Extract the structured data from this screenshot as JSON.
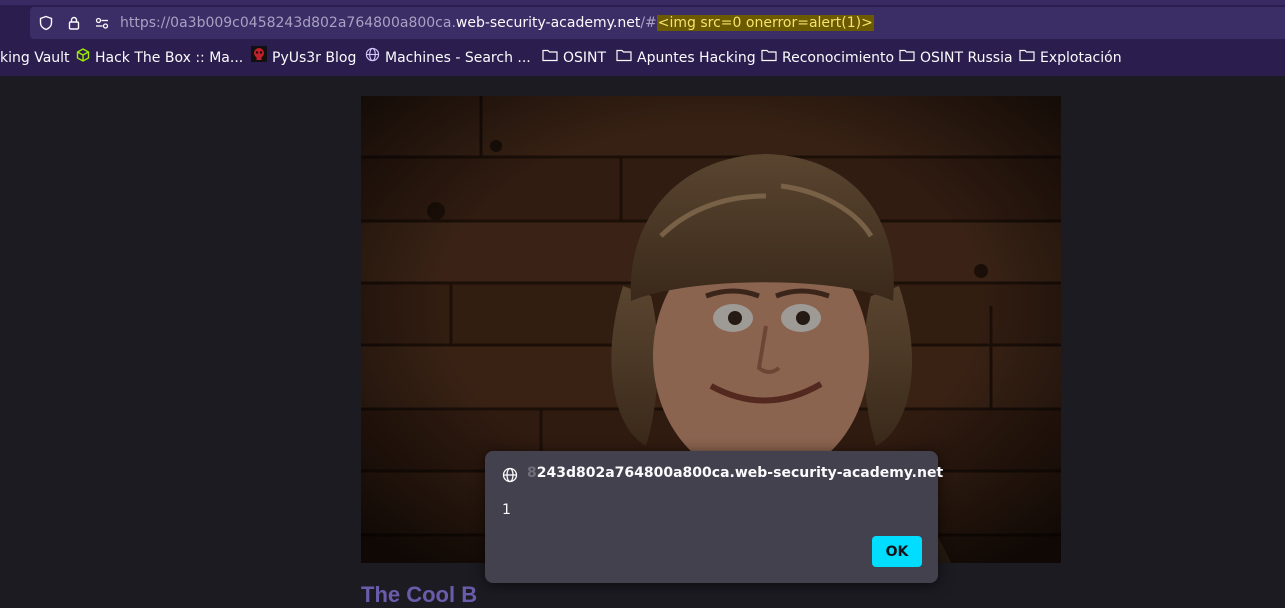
{
  "browser": {
    "url": {
      "prefix": "https://0a3b009c0458243d802a764800a800ca.",
      "host": "web-security-academy.net",
      "path": "/#",
      "highlight": "<img src=0 onerror=alert(1)>"
    },
    "bookmarks": [
      {
        "label": "king Vault",
        "icon": "none"
      },
      {
        "label": "Hack The Box :: Ma...",
        "icon": "htb-cube-icon"
      },
      {
        "label": "PyUs3r Blog",
        "icon": "skull-icon"
      },
      {
        "label": "Machines - Search ...",
        "icon": "globe-icon"
      },
      {
        "label": "OSINT",
        "icon": "folder-icon"
      },
      {
        "label": "Apuntes Hacking",
        "icon": "folder-icon"
      },
      {
        "label": "Reconocimiento",
        "icon": "folder-icon"
      },
      {
        "label": "OSINT Russia",
        "icon": "folder-icon"
      },
      {
        "label": "Explotación",
        "icon": "folder-icon"
      }
    ]
  },
  "page": {
    "hero_alt": "man in fur trapper hat",
    "heading_peek": "The Cool B"
  },
  "dialog": {
    "origin_faded": "8",
    "origin": "243d802a764800a800ca.web-security-academy.net",
    "message": "1",
    "ok_label": "OK"
  },
  "colors": {
    "accent": "#00ddff",
    "chrome": "#2b1d4e",
    "dialog_bg": "#42414d"
  }
}
